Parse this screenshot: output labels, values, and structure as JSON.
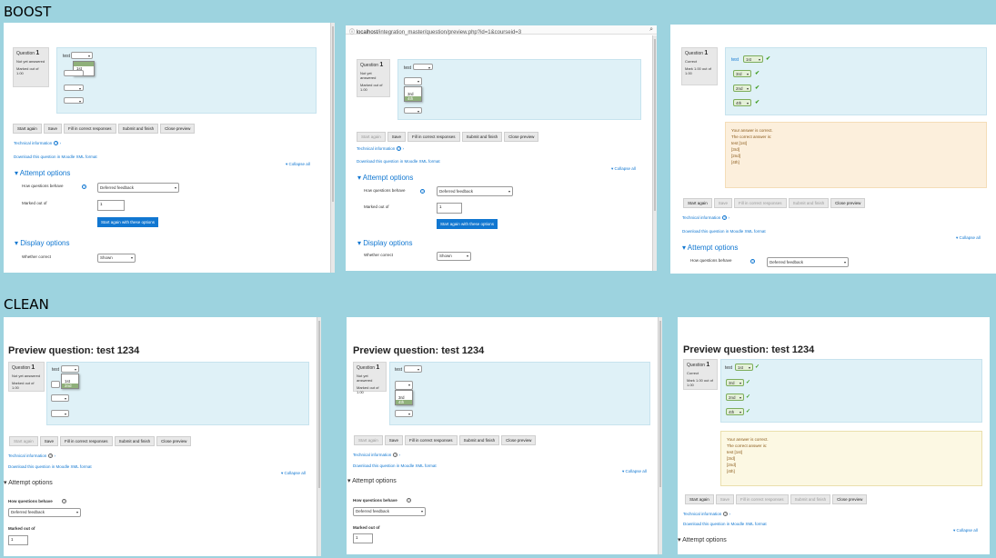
{
  "labels": {
    "boost": "BOOST",
    "clean": "CLEAN"
  },
  "url": {
    "host": "localhost",
    "path": "/integration_master/question/preview.php?id=1&courseid=3"
  },
  "page_title": "Preview question: test 1234",
  "info": {
    "question_label": "Question",
    "question_num": "1",
    "status_not_answered": "Not yet answered",
    "status_correct": "Correct",
    "marked_out_of": "Marked out of 1.00",
    "mark_result": "Mark 1.00 out of 1.00"
  },
  "question": {
    "text": "test",
    "arrow": "▾",
    "check": "✔",
    "check_thin": "✓"
  },
  "dropdown1": [
    "",
    "1st",
    "2nd"
  ],
  "dropdown2": [
    "",
    "3rd",
    "4th"
  ],
  "answers": [
    "1st",
    "3rd",
    "2nd",
    "4th"
  ],
  "buttons": {
    "start_again": "Start again",
    "save": "Save",
    "fill_correct": "Fill in correct responses",
    "submit_finish": "Submit and finish",
    "close_preview": "Close preview"
  },
  "links": {
    "technical_info": "Technical information",
    "download_xml": "Download this question in Moodle XML format",
    "collapse_all": "Collapse all"
  },
  "sections": {
    "attempt_options": "Attempt options",
    "display_options": "Display options"
  },
  "form": {
    "how_behave": "How questions behave",
    "behaviour_value": "Deferred feedback",
    "marked_out_of": "Marked out of",
    "marked_value": "1",
    "start_again_options": "Start again with these options",
    "whether_correct": "Whether correct",
    "whether_value": "Shown"
  },
  "feedback": {
    "line1": "Your answer is correct.",
    "line2": "The correct answer is:",
    "line3": "test [1st]",
    "line4": "[3rd]",
    "line5": "[2nd]",
    "line6": "[4th]"
  }
}
